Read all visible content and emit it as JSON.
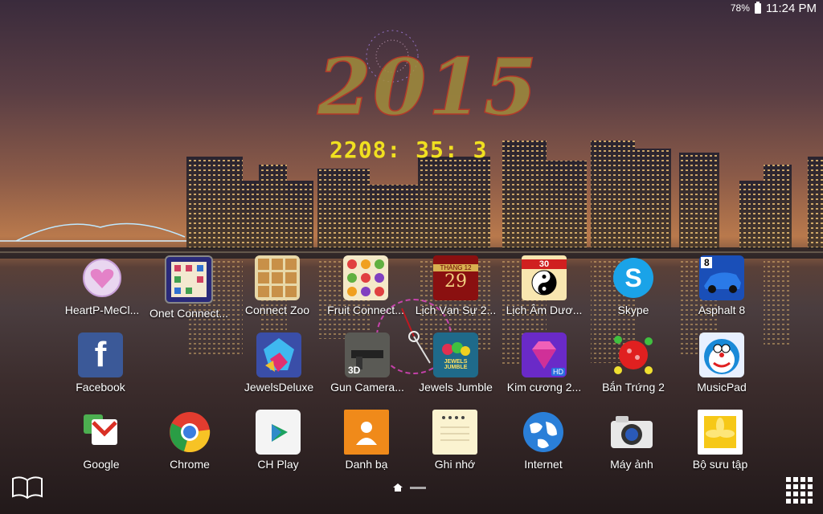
{
  "status_bar": {
    "battery": "78%",
    "time": "11:24 PM"
  },
  "widget": {
    "year": "2015",
    "clock": "2208: 35: 3"
  },
  "apps_row1": [
    {
      "label": "HeartP-MeCl...",
      "icon": "heart-icon"
    },
    {
      "label": "Onet Connect...",
      "icon": "onet-icon"
    },
    {
      "label": "Connect Zoo",
      "icon": "zoo-icon"
    },
    {
      "label": "Fruit Connect...",
      "icon": "fruit-icon"
    },
    {
      "label": "Lịch Vạn Sự 2...",
      "icon": "calendar-icon",
      "month": "THÁNG 12",
      "day": "29"
    },
    {
      "label": "Lịch Âm Dươ...",
      "icon": "yinyang-icon",
      "day": "30"
    },
    {
      "label": "Skype",
      "icon": "skype-icon"
    },
    {
      "label": "Asphalt 8",
      "icon": "car-icon",
      "badge": "8"
    }
  ],
  "apps_row2": [
    {
      "label": "Facebook",
      "icon": "facebook-icon"
    },
    {
      "label": "JewelsDeluxe",
      "icon": "jewels-deluxe-icon"
    },
    {
      "label": "Gun Camera...",
      "icon": "gun-icon",
      "badge": "3D"
    },
    {
      "label": "Jewels Jumble",
      "icon": "jewels-jumble-icon",
      "text": "JEWELS JUMBLE"
    },
    {
      "label": "Kim cương 2...",
      "icon": "diamond-icon",
      "badge": "HD"
    },
    {
      "label": "Bắn Trứng 2",
      "icon": "eggs-icon"
    },
    {
      "label": "MusicPad",
      "icon": "doraemon-icon"
    }
  ],
  "dock": [
    {
      "label": "Google",
      "icon": "gmail-icon"
    },
    {
      "label": "Chrome",
      "icon": "chrome-icon"
    },
    {
      "label": "CH Play",
      "icon": "play-store-icon"
    },
    {
      "label": "Danh bạ",
      "icon": "contacts-icon"
    },
    {
      "label": "Ghi nhớ",
      "icon": "memo-icon"
    },
    {
      "label": "Internet",
      "icon": "globe-icon"
    },
    {
      "label": "Máy ảnh",
      "icon": "camera-icon"
    },
    {
      "label": "Bộ sưu tập",
      "icon": "gallery-icon"
    }
  ],
  "colors": {
    "accent_clock": "#f0e020",
    "year_fill": "#a08c3c",
    "year_outline": "#b23a2a"
  }
}
